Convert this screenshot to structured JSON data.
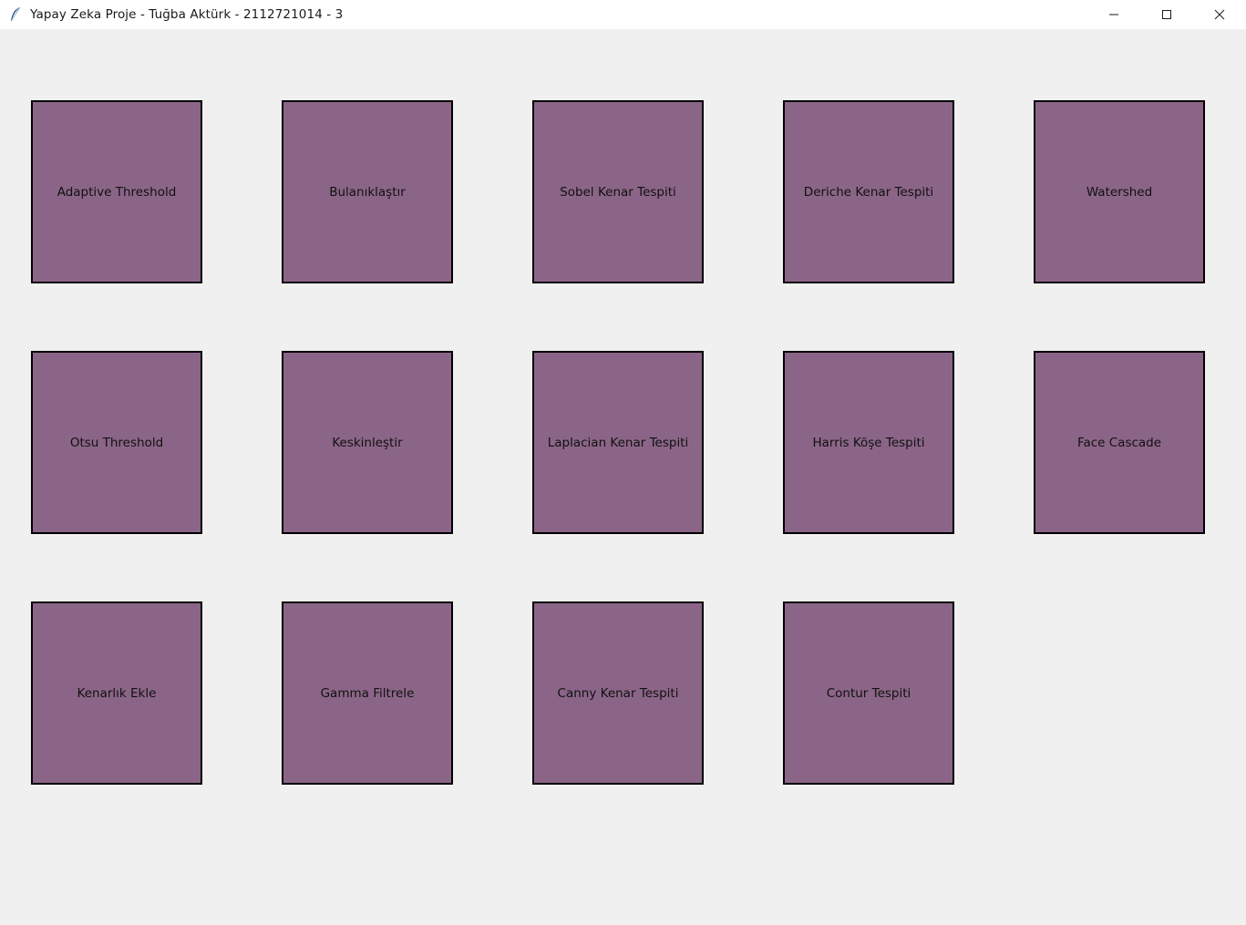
{
  "window": {
    "title": "Yapay Zeka Proje - Tuğba Aktürk - 2112721014 - 3",
    "icon": "feather-icon",
    "controls": [
      "minimize-icon",
      "maximize-icon",
      "close-icon"
    ]
  },
  "colors": {
    "background": "#f0f0f0",
    "tile": "#8b6587",
    "tile_border": "#000000"
  },
  "buttons": [
    {
      "label": "Adaptive Threshold"
    },
    {
      "label": "Bulanıklaştır"
    },
    {
      "label": "Sobel Kenar Tespiti"
    },
    {
      "label": "Deriche Kenar Tespiti"
    },
    {
      "label": "Watershed"
    },
    {
      "label": "Otsu Threshold"
    },
    {
      "label": "Keskinleştir"
    },
    {
      "label": "Laplacian Kenar Tespiti"
    },
    {
      "label": "Harris Köşe Tespiti"
    },
    {
      "label": "Face Cascade"
    },
    {
      "label": "Kenarlık Ekle"
    },
    {
      "label": "Gamma Filtrele"
    },
    {
      "label": "Canny Kenar Tespiti"
    },
    {
      "label": "Contur Tespiti"
    }
  ]
}
